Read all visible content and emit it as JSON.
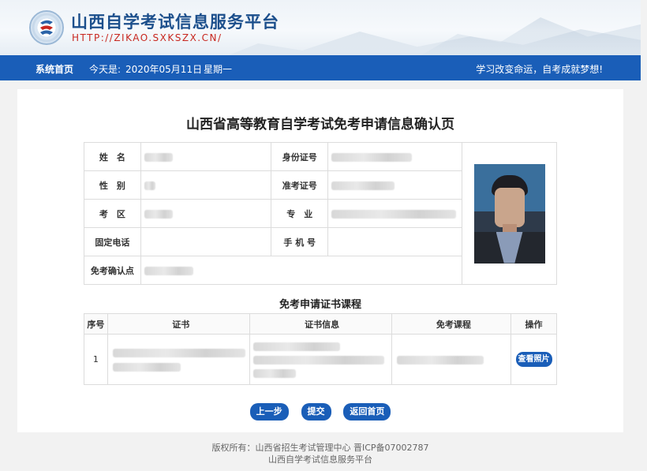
{
  "header": {
    "site_title": "山西自学考试信息服务平台",
    "site_url": "HTTP://ZIKAO.SXKSZX.CN/"
  },
  "navbar": {
    "home": "系统首页",
    "date_label": "今天是:",
    "date": "2020年05月11日",
    "weekday": "星期一",
    "slogan": "学习改变命运，自考成就梦想!"
  },
  "page": {
    "title": "山西省高等教育自学考试免考申请信息确认页"
  },
  "info": {
    "name_label": "姓　名",
    "id_label": "身份证号",
    "gender_label": "性　别",
    "exam_no_label": "准考证号",
    "area_label": "考　区",
    "major_label": "专　业",
    "phone_label": "固定电话",
    "mobile_label": "手 机 号",
    "site_label": "免考确认点"
  },
  "courses": {
    "title": "免考申请证书课程",
    "headers": {
      "no": "序号",
      "cert": "证书",
      "cert_info": "证书信息",
      "course": "免考课程",
      "op": "操作"
    },
    "rows": [
      {
        "no": "1",
        "view_label": "查看照片"
      }
    ]
  },
  "actions": {
    "prev": "上一步",
    "submit": "提交",
    "home": "返回首页"
  },
  "footer": {
    "line1": "版权所有：山西省招生考试管理中心   晋ICP备07002787",
    "line2": "山西自学考试信息服务平台"
  },
  "colors": {
    "primary": "#1a5eb8",
    "url_red": "#c8271f",
    "title_blue": "#1c4f8c"
  }
}
